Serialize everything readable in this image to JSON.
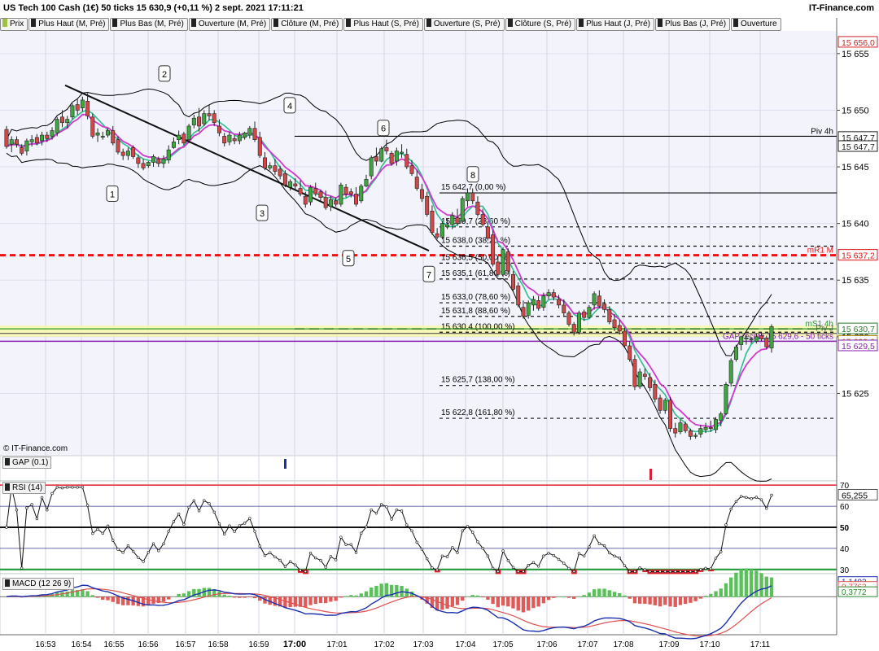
{
  "header": {
    "title": "US Tech 100 Cash (1€) 50 ticks 15 630,9 (+0,11 %) 2 sept. 2021 17:11:21",
    "brand": "IT-Finance.com"
  },
  "tabs": [
    "Prix",
    "Plus Haut (M, Pré)",
    "Plus Bas (M, Pré)",
    "Ouverture (M, Pré)",
    "Clôture (M, Pré)",
    "Plus Haut (S, Pré)",
    "Ouverture (S, Pré)",
    "Clôture (S, Pré)",
    "Plus Haut (J, Pré)",
    "Plus Bas (J, Pré)",
    "Ouverture"
  ],
  "copyright": "© IT-Finance.com",
  "colors": {
    "bull": "#3fa63f",
    "bear": "#d04848",
    "sma": "#2fbf8f",
    "ema": "#d03ad0",
    "boll": "#000000",
    "pivot_red": "#ee1111",
    "gap_purple": "#9922cc",
    "rsi_line": "#111111",
    "macd_line": "#1a2fb0",
    "signal_line": "#e05050",
    "hist_pos": "#5bc05b",
    "hist_neg": "#e05a5a"
  },
  "chart_data": [
    {
      "type": "candlestick",
      "name": "price",
      "ylim": [
        15619.5,
        15657
      ],
      "y_ticks": [
        15625,
        15630,
        15635,
        15640,
        15645,
        15650,
        15655
      ],
      "y_tick_labels": [
        "15 625",
        "15 630",
        "15 635",
        "15 640",
        "15 645",
        "15 650",
        "15 655"
      ],
      "x_ticks": [
        "16:53",
        "16:54",
        "16:55",
        "16:56",
        "16:57",
        "16:58",
        "16:59",
        "17:00",
        "17:01",
        "17:02",
        "17:03",
        "17:04",
        "17:05",
        "17:06",
        "17:07",
        "17:08",
        "17:09",
        "17:10",
        "17:11"
      ],
      "right_badges": [
        {
          "text": "15 656,0",
          "value": 15656.0,
          "color": "#cc2222"
        },
        {
          "text": "15 647,7",
          "value": 15647.6,
          "color": "#222222"
        },
        {
          "text": "15 647,7",
          "value": 15646.8,
          "color": "#222222"
        },
        {
          "text": "15 637,2",
          "value": 15637.2,
          "color": "#dd1111"
        },
        {
          "text": "15 630,7",
          "value": 15630.7,
          "color": "#2a7a2a"
        },
        {
          "text": "15 629,6",
          "value": 15629.6,
          "color": "#b07a00"
        },
        {
          "text": "15 629,5",
          "value": 15629.2,
          "color": "#8a1fb0"
        }
      ],
      "fib_levels": [
        {
          "value": 15642.7,
          "label": "15 642,7 (0,00 %)",
          "dashed": false
        },
        {
          "value": 15639.7,
          "label": "15 639,7 (23,60 %)",
          "dashed": true
        },
        {
          "value": 15638.0,
          "label": "15 638,0 (38,20 %)",
          "dashed": true
        },
        {
          "value": 15636.5,
          "label": "15 636,5 (50,00 %)",
          "dashed": true
        },
        {
          "value": 15635.1,
          "label": "15 635,1 (61,80 %)",
          "dashed": true
        },
        {
          "value": 15633.0,
          "label": "15 633,0 (78,60 %)",
          "dashed": true
        },
        {
          "value": 15631.8,
          "label": "15 631,8 (88,60 %)",
          "dashed": true
        },
        {
          "value": 15630.4,
          "label": "15 630,4 (100,00 %)",
          "dashed": true
        },
        {
          "value": 15625.7,
          "label": "15 625,7 (138,00 %)",
          "dashed": true
        },
        {
          "value": 15622.8,
          "label": "15 622,8 (161,80 %)",
          "dashed": true
        }
      ],
      "level_lines": [
        {
          "value": 15647.7,
          "label": "Piv 4h",
          "color": "#000000"
        },
        {
          "value": 15637.2,
          "label": "mR1 M",
          "color": "#ee1111"
        },
        {
          "value": 15630.7,
          "label": "mS1 4h",
          "color": "#2a9a2a"
        },
        {
          "value": 15630.3,
          "label": "Piv J",
          "color": "#555555"
        },
        {
          "value": 15629.6,
          "label": "GAP recnte 15 629,6 - 50 ticks",
          "color": "#8a1fb0"
        }
      ],
      "wave_labels": [
        "1",
        "2",
        "3",
        "4",
        "5",
        "6",
        "7",
        "8"
      ],
      "candles": [
        [
          15648.3,
          15648.6,
          15646.6,
          15646.8
        ],
        [
          15647.0,
          15647.7,
          15646.3,
          15647.4
        ],
        [
          15647.4,
          15647.7,
          15646.7,
          15647.0
        ],
        [
          15646.7,
          15647.0,
          15646.0,
          15646.2
        ],
        [
          15646.4,
          15647.5,
          15646.0,
          15647.3
        ],
        [
          15647.2,
          15647.8,
          15646.8,
          15647.4
        ],
        [
          15647.6,
          15647.9,
          15646.9,
          15647.1
        ],
        [
          15647.3,
          15648.1,
          15646.9,
          15647.8
        ],
        [
          15647.8,
          15648.1,
          15647.2,
          15647.5
        ],
        [
          15647.7,
          15648.5,
          15647.4,
          15648.2
        ],
        [
          15648.0,
          15649.4,
          15647.7,
          15649.2
        ],
        [
          15649.4,
          15650.0,
          15648.5,
          15648.9
        ],
        [
          15648.9,
          15649.5,
          15648.4,
          15649.2
        ],
        [
          15649.4,
          15650.6,
          15649.2,
          15650.4
        ],
        [
          15650.5,
          15651.0,
          15649.6,
          15650.0
        ],
        [
          15650.2,
          15651.2,
          15649.9,
          15650.9
        ],
        [
          15650.8,
          15651.5,
          15649.2,
          15649.5
        ],
        [
          15649.4,
          15649.7,
          15647.5,
          15647.7
        ],
        [
          15647.8,
          15648.4,
          15647.2,
          15648.0
        ],
        [
          15647.7,
          15648.1,
          15647.4,
          15647.7
        ],
        [
          15647.8,
          15648.4,
          15647.6,
          15648.2
        ],
        [
          15648.2,
          15648.6,
          15646.9,
          15647.1
        ],
        [
          15647.4,
          15647.7,
          15646.1,
          15646.3
        ],
        [
          15646.3,
          15646.6,
          15645.6,
          15646.0
        ],
        [
          15646.0,
          15646.7,
          15645.6,
          15646.4
        ],
        [
          15646.7,
          15646.9,
          15645.7,
          15645.9
        ],
        [
          15645.8,
          15646.1,
          15644.9,
          15645.3
        ],
        [
          15645.3,
          15645.7,
          15644.7,
          15644.9
        ],
        [
          15645.1,
          15645.5,
          15644.9,
          15645.4
        ],
        [
          15645.4,
          15646.1,
          15645.0,
          15645.9
        ],
        [
          15645.7,
          15645.9,
          15645.0,
          15645.3
        ],
        [
          15645.3,
          15646.0,
          15644.9,
          15645.7
        ],
        [
          15645.6,
          15646.9,
          15645.3,
          15646.5
        ],
        [
          15646.7,
          15647.6,
          15646.6,
          15647.2
        ],
        [
          15647.4,
          15648.2,
          15647.0,
          15647.8
        ],
        [
          15647.9,
          15648.1,
          15646.9,
          15647.1
        ],
        [
          15647.4,
          15648.8,
          15647.1,
          15648.6
        ],
        [
          15648.7,
          15649.6,
          15648.4,
          15649.3
        ],
        [
          15649.4,
          15650.2,
          15648.1,
          15648.6
        ],
        [
          15648.8,
          15650.0,
          15648.6,
          15649.7
        ],
        [
          15649.7,
          15650.5,
          15649.1,
          15649.5
        ],
        [
          15649.7,
          15650.0,
          15648.6,
          15648.9
        ],
        [
          15648.6,
          15649.2,
          15647.7,
          15648.0
        ],
        [
          15647.7,
          15648.0,
          15646.8,
          15647.1
        ],
        [
          15647.2,
          15648.1,
          15646.9,
          15647.8
        ],
        [
          15647.5,
          15647.8,
          15647.0,
          15647.3
        ],
        [
          15647.3,
          15648.1,
          15647.0,
          15647.8
        ],
        [
          15647.6,
          15648.1,
          15647.4,
          15648.0
        ],
        [
          15647.8,
          15648.6,
          15647.5,
          15648.4
        ],
        [
          15648.4,
          15649.0,
          15647.2,
          15647.4
        ],
        [
          15647.6,
          15648.1,
          15645.8,
          15646.0
        ],
        [
          15645.8,
          15646.3,
          15644.7,
          15644.9
        ],
        [
          15644.9,
          15645.4,
          15644.7,
          15645.1
        ],
        [
          15645.1,
          15645.7,
          15644.3,
          15644.6
        ],
        [
          15644.8,
          15645.1,
          15643.9,
          15644.2
        ],
        [
          15644.4,
          15644.7,
          15643.2,
          15643.4
        ],
        [
          15643.2,
          15643.9,
          15642.9,
          15643.7
        ],
        [
          15643.5,
          15644.0,
          15643.0,
          15643.3
        ],
        [
          15643.1,
          15643.8,
          15642.4,
          15642.6
        ],
        [
          15642.4,
          15642.8,
          15641.4,
          15641.7
        ],
        [
          15641.9,
          15643.4,
          15641.6,
          15643.2
        ],
        [
          15643.1,
          15643.6,
          15642.4,
          15642.6
        ],
        [
          15642.8,
          15643.0,
          15642.0,
          15642.3
        ],
        [
          15642.3,
          15642.9,
          15641.2,
          15641.4
        ],
        [
          15641.5,
          15642.4,
          15641.1,
          15642.1
        ],
        [
          15642.0,
          15642.3,
          15641.5,
          15641.7
        ],
        [
          15641.7,
          15643.6,
          15641.5,
          15643.4
        ],
        [
          15643.2,
          15643.5,
          15642.3,
          15642.6
        ],
        [
          15642.8,
          15643.1,
          15642.3,
          15642.6
        ],
        [
          15642.6,
          15643.2,
          15641.5,
          15641.7
        ],
        [
          15642.0,
          15643.5,
          15641.8,
          15643.3
        ],
        [
          15643.3,
          15644.3,
          15643.2,
          15643.9
        ],
        [
          15644.2,
          15646.0,
          15643.9,
          15645.8
        ],
        [
          15645.9,
          15646.7,
          15645.1,
          15645.5
        ],
        [
          15645.5,
          15646.8,
          15645.4,
          15646.6
        ],
        [
          15646.7,
          15647.4,
          15646.1,
          15646.4
        ],
        [
          15646.2,
          15646.4,
          15645.1,
          15645.3
        ],
        [
          15645.5,
          15646.7,
          15645.1,
          15646.4
        ],
        [
          15646.2,
          15647.0,
          15645.8,
          15646.3
        ],
        [
          15646.1,
          15646.6,
          15644.8,
          15645.0
        ],
        [
          15645.1,
          15645.6,
          15644.2,
          15644.4
        ],
        [
          15644.1,
          15644.7,
          15642.9,
          15643.1
        ],
        [
          15643.0,
          15643.5,
          15641.9,
          15642.2
        ],
        [
          15642.4,
          15642.8,
          15640.6,
          15640.8
        ],
        [
          15641.1,
          15641.6,
          15639.0,
          15639.2
        ],
        [
          15639.1,
          15639.6,
          15638.6,
          15638.8
        ],
        [
          15638.8,
          15640.2,
          15638.6,
          15640.0
        ],
        [
          15639.7,
          15640.4,
          15639.5,
          15639.9
        ],
        [
          15639.9,
          15641.0,
          15639.5,
          15640.7
        ],
        [
          15640.5,
          15641.3,
          15639.8,
          15640.0
        ],
        [
          15640.2,
          15642.4,
          15640.0,
          15642.2
        ],
        [
          15642.0,
          15643.1,
          15641.5,
          15642.7
        ],
        [
          15642.7,
          15643.1,
          15641.7,
          15642.0
        ],
        [
          15641.9,
          15642.4,
          15640.6,
          15640.8
        ],
        [
          15640.8,
          15641.3,
          15639.7,
          15639.9
        ],
        [
          15639.7,
          15640.2,
          15638.5,
          15638.7
        ],
        [
          15639.0,
          15639.4,
          15636.2,
          15636.4
        ],
        [
          15636.6,
          15637.1,
          15635.3,
          15635.5
        ],
        [
          15635.5,
          15637.9,
          15635.3,
          15637.7
        ],
        [
          15637.5,
          15637.8,
          15635.5,
          15635.8
        ],
        [
          15635.5,
          15635.8,
          15634.0,
          15634.2
        ],
        [
          15634.5,
          15634.8,
          15632.6,
          15632.8
        ],
        [
          15632.6,
          15633.2,
          15631.6,
          15631.8
        ],
        [
          15631.9,
          15633.2,
          15631.6,
          15633.0
        ],
        [
          15632.8,
          15633.6,
          15632.3,
          15633.3
        ],
        [
          15633.2,
          15633.6,
          15632.3,
          15632.5
        ],
        [
          15632.6,
          15633.9,
          15632.3,
          15633.6
        ],
        [
          15633.6,
          15634.2,
          15633.3,
          15633.9
        ],
        [
          15633.9,
          15634.2,
          15633.2,
          15633.5
        ],
        [
          15633.3,
          15633.7,
          15632.5,
          15632.8
        ],
        [
          15632.8,
          15633.3,
          15631.8,
          15632.1
        ],
        [
          15632.1,
          15632.3,
          15630.9,
          15631.1
        ],
        [
          15631.1,
          15631.3,
          15630.1,
          15630.4
        ],
        [
          15630.4,
          15632.3,
          15630.2,
          15632.1
        ],
        [
          15632.2,
          15632.4,
          15631.4,
          15631.7
        ],
        [
          15631.7,
          15632.8,
          15631.6,
          15632.6
        ],
        [
          15632.8,
          15634.0,
          15632.4,
          15633.8
        ],
        [
          15633.6,
          15634.1,
          15632.5,
          15632.7
        ],
        [
          15632.9,
          15633.3,
          15632.1,
          15632.4
        ],
        [
          15632.4,
          15632.7,
          15631.1,
          15631.3
        ],
        [
          15631.5,
          15632.0,
          15630.5,
          15630.8
        ],
        [
          15631.0,
          15631.5,
          15630.2,
          15630.5
        ],
        [
          15630.5,
          15630.8,
          15629.0,
          15629.2
        ],
        [
          15629.2,
          15629.6,
          15627.8,
          15628.0
        ],
        [
          15628.0,
          15628.4,
          15625.3,
          15625.6
        ],
        [
          15625.6,
          15627.2,
          15625.4,
          15626.9
        ],
        [
          15626.7,
          15627.2,
          15626.2,
          15626.5
        ],
        [
          15626.4,
          15626.8,
          15625.2,
          15625.5
        ],
        [
          15625.8,
          15626.2,
          15624.2,
          15624.5
        ],
        [
          15624.6,
          15624.9,
          15623.2,
          15623.5
        ],
        [
          15623.5,
          15624.6,
          15623.2,
          15624.4
        ],
        [
          15624.4,
          15624.7,
          15621.6,
          15621.9
        ],
        [
          15621.9,
          15622.4,
          15621.1,
          15621.5
        ],
        [
          15621.6,
          15622.7,
          15621.4,
          15622.4
        ],
        [
          15622.3,
          15622.5,
          15621.5,
          15621.7
        ],
        [
          15621.7,
          15621.9,
          15620.9,
          15621.2
        ],
        [
          15621.2,
          15621.5,
          15621.0,
          15621.3
        ],
        [
          15621.4,
          15622.2,
          15621.1,
          15621.9
        ],
        [
          15621.8,
          15622.4,
          15621.5,
          15622.0
        ],
        [
          15622.0,
          15622.6,
          15621.6,
          15621.9
        ],
        [
          15621.8,
          15622.9,
          15621.5,
          15622.7
        ],
        [
          15622.6,
          15623.4,
          15622.1,
          15623.2
        ],
        [
          15623.2,
          15626.0,
          15623.1,
          15625.8
        ],
        [
          15625.9,
          15628.1,
          15625.6,
          15627.9
        ],
        [
          15628.0,
          15629.3,
          15627.8,
          15629.1
        ],
        [
          15629.3,
          15630.1,
          15628.8,
          15630.0
        ],
        [
          15629.8,
          15630.2,
          15629.3,
          15629.9
        ],
        [
          15629.8,
          15630.0,
          15629.4,
          15629.8
        ],
        [
          15629.6,
          15630.3,
          15629.4,
          15630.0
        ],
        [
          15630.1,
          15630.4,
          15629.6,
          15629.8
        ],
        [
          15629.9,
          15630.1,
          15628.9,
          15629.1
        ],
        [
          15629.0,
          15631.1,
          15628.6,
          15630.9
        ]
      ]
    },
    {
      "type": "bar",
      "name": "GAP (0.1)",
      "markers": [
        {
          "sign": "negative",
          "color": "#1a2fb0"
        },
        {
          "sign": "positive",
          "color": "#d8203a"
        }
      ]
    },
    {
      "type": "line",
      "name": "RSI (14)",
      "ylim": [
        28,
        72
      ],
      "y_ticks": [
        30,
        40,
        50,
        60,
        70
      ],
      "last_value_label": "65,255",
      "last_value": 65.255,
      "levels": [
        70,
        60,
        50,
        40,
        30
      ]
    },
    {
      "type": "line",
      "name": "MACD (12 26 9)",
      "ylim": [
        -2.9,
        1.75
      ],
      "badges": [
        {
          "text": "1,1493",
          "value": 1.1493,
          "color": "#1a2fb0"
        },
        {
          "text": "0,7763",
          "value": 0.7763,
          "color": "#e05050"
        },
        {
          "text": "0,3772",
          "value": 0.3772,
          "color": "#2a8a2a"
        }
      ]
    }
  ]
}
